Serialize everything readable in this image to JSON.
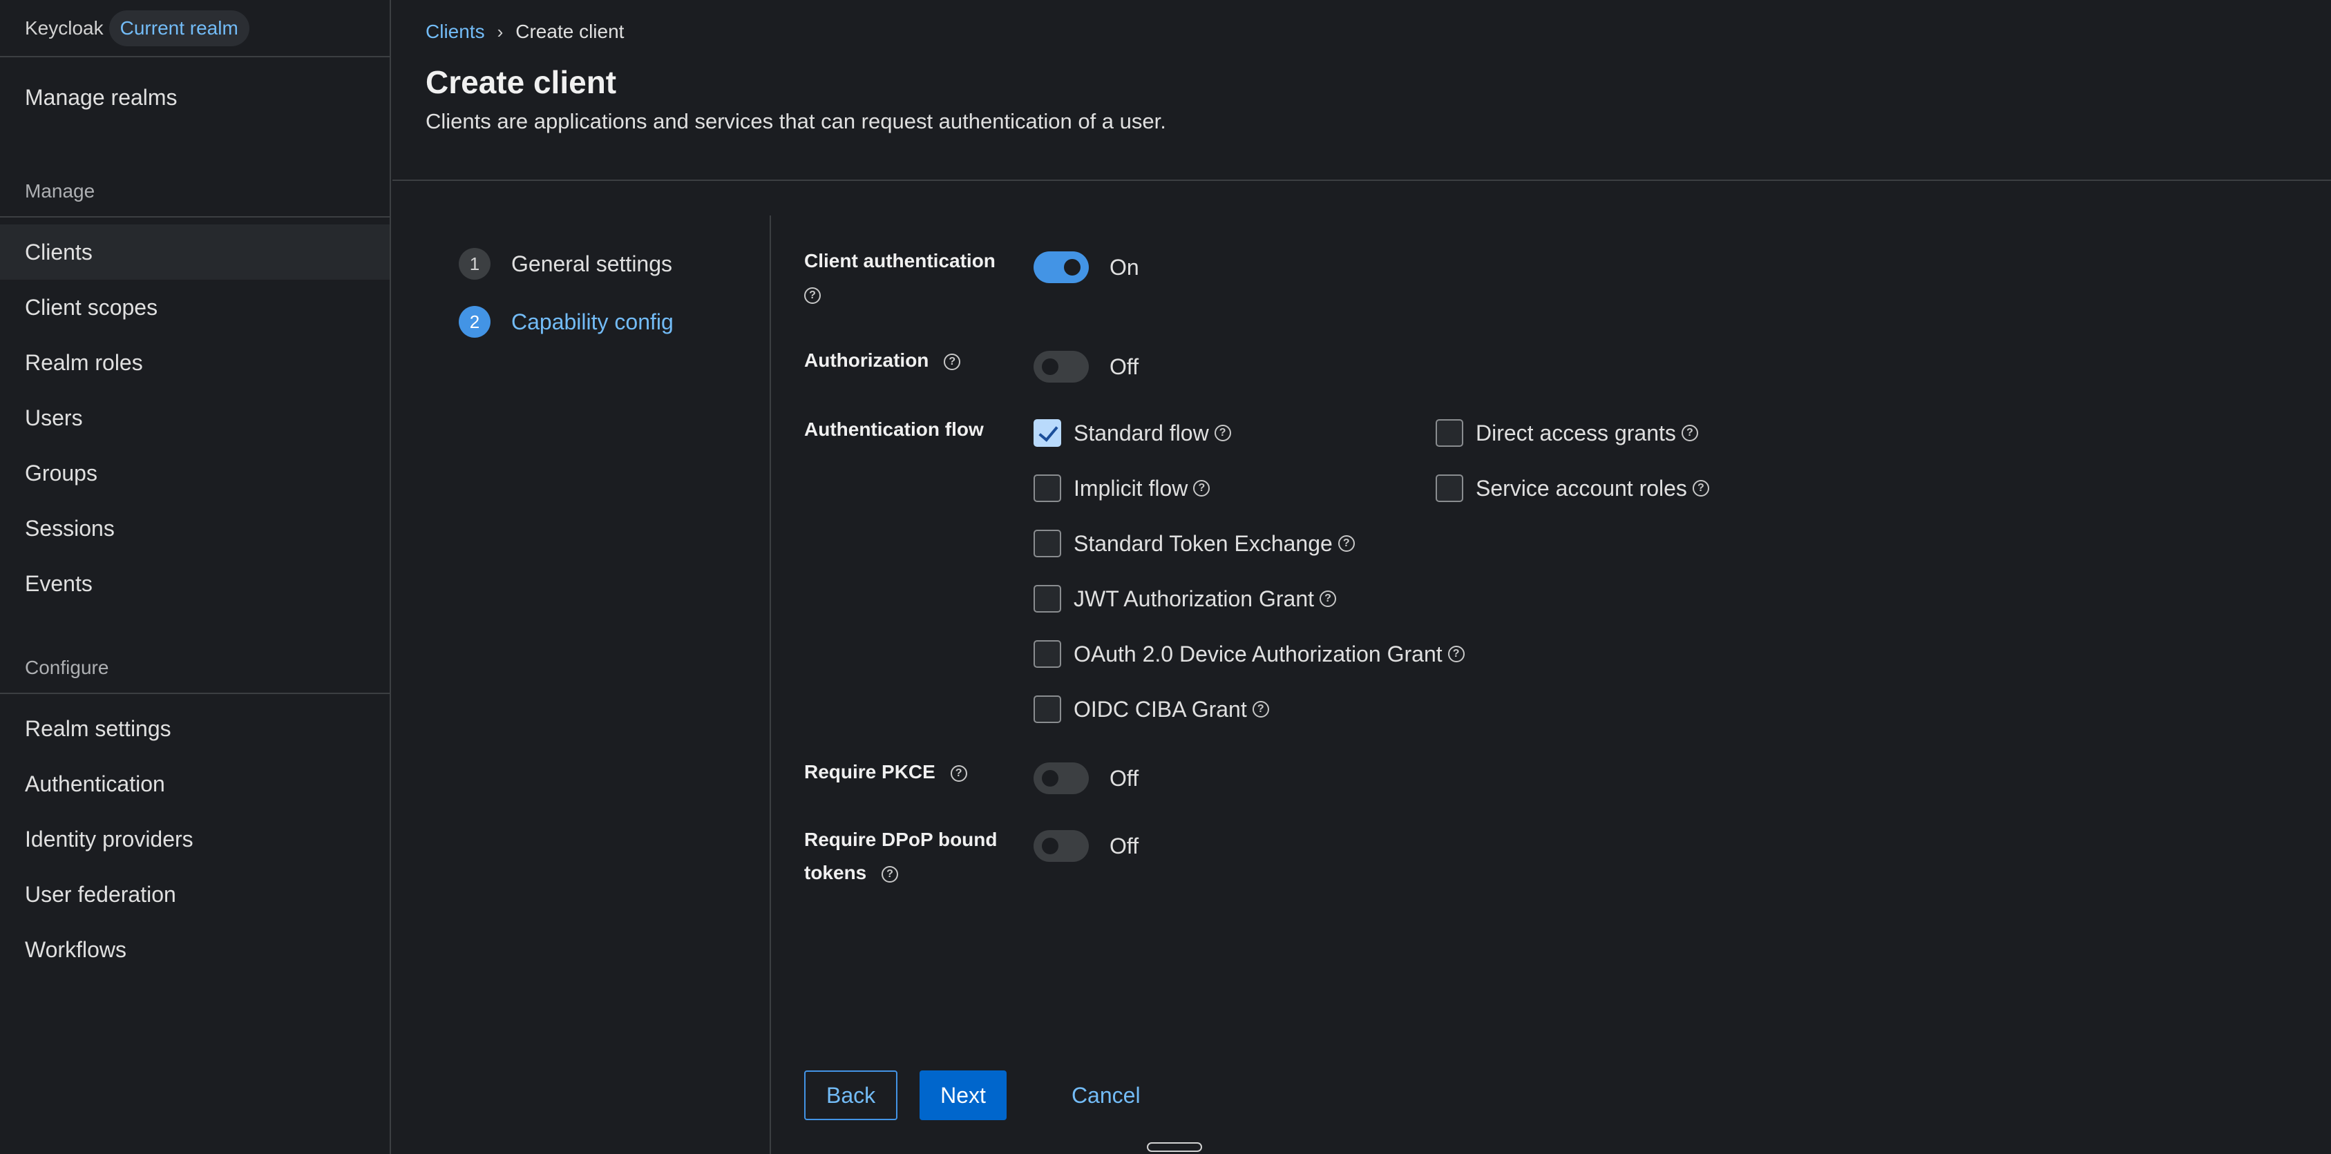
{
  "sidebar": {
    "brand": "Keycloak",
    "realm_chip": "Current realm",
    "manage_realms": "Manage realms",
    "manage_heading": "Manage",
    "manage_items": [
      "Clients",
      "Client scopes",
      "Realm roles",
      "Users",
      "Groups",
      "Sessions",
      "Events"
    ],
    "configure_heading": "Configure",
    "configure_items": [
      "Realm settings",
      "Authentication",
      "Identity providers",
      "User federation",
      "Workflows"
    ]
  },
  "breadcrumb": {
    "parent": "Clients",
    "separator": "›",
    "current": "Create client"
  },
  "page": {
    "title": "Create client",
    "description": "Clients are applications and services that can request authentication of a user."
  },
  "wizard": {
    "steps": [
      {
        "number": "1",
        "label": "General settings",
        "state": "done"
      },
      {
        "number": "2",
        "label": "Capability config",
        "state": "current"
      }
    ]
  },
  "form": {
    "client_auth": {
      "label": "Client authentication",
      "value": "On",
      "enabled": true
    },
    "authorization": {
      "label": "Authorization",
      "value": "Off",
      "enabled": false
    },
    "auth_flow": {
      "label": "Authentication flow",
      "options": [
        {
          "label": "Standard flow",
          "checked": true
        },
        {
          "label": "Direct access grants",
          "checked": false
        },
        {
          "label": "Implicit flow",
          "checked": false
        },
        {
          "label": "Service account roles",
          "checked": false
        },
        {
          "label": "Standard Token Exchange",
          "checked": false
        },
        {
          "label": "JWT Authorization Grant",
          "checked": false
        },
        {
          "label": "OAuth 2.0 Device Authorization Grant",
          "checked": false
        },
        {
          "label": "OIDC CIBA Grant",
          "checked": false
        }
      ]
    },
    "pkce": {
      "label": "Require PKCE",
      "value": "Off",
      "enabled": false
    },
    "dpop": {
      "label_line1": "Require DPoP bound",
      "label_line2": "tokens",
      "value": "Off",
      "enabled": false
    },
    "help_glyph": "?"
  },
  "actions": {
    "back": "Back",
    "next": "Next",
    "cancel": "Cancel"
  },
  "colors": {
    "accent": "#4394e5",
    "link": "#73bcf7",
    "primary_button": "#0066cc",
    "background": "#1b1d21"
  }
}
